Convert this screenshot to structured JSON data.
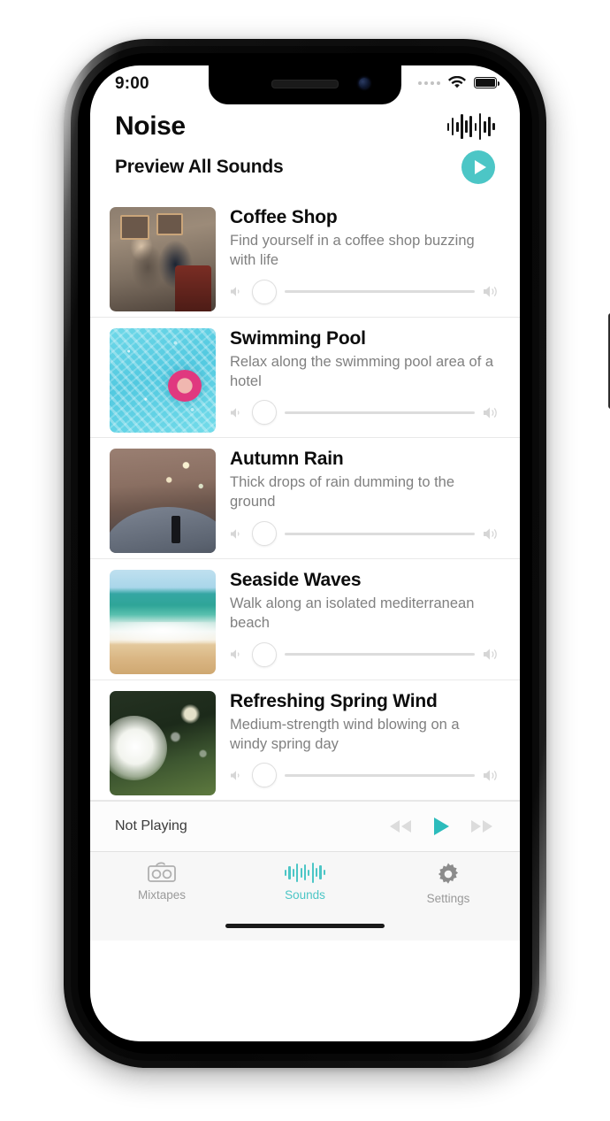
{
  "status_bar": {
    "time": "9:00",
    "signal_icon": "signal-dots-icon",
    "wifi_icon": "wifi-icon",
    "battery_icon": "battery-full-icon"
  },
  "header": {
    "app_title": "Noise",
    "waveform_icon": "waveform-icon",
    "preview_label": "Preview All Sounds",
    "preview_play_icon": "play-circle-icon"
  },
  "colors": {
    "accent": "#4cc6c6",
    "title_text": "#0c0c0c",
    "description_text": "#808080",
    "track": "#dcdcdc",
    "tab_inactive": "#9a9a9a"
  },
  "sounds": [
    {
      "title": "Coffee Shop",
      "description": "Find yourself in a coffee shop buzzing with life",
      "thumbnail": "coffee-shop-photo",
      "volume": 0,
      "volume_low_icon": "speaker-low-icon",
      "volume_high_icon": "speaker-high-icon"
    },
    {
      "title": "Swimming Pool",
      "description": "Relax along the swimming pool area of a hotel",
      "thumbnail": "swimming-pool-photo",
      "volume": 0,
      "volume_low_icon": "speaker-low-icon",
      "volume_high_icon": "speaker-high-icon"
    },
    {
      "title": "Autumn Rain",
      "description": "Thick drops of rain dumming to the ground",
      "thumbnail": "autumn-rain-photo",
      "volume": 0,
      "volume_low_icon": "speaker-low-icon",
      "volume_high_icon": "speaker-high-icon"
    },
    {
      "title": "Seaside Waves",
      "description": "Walk along an isolated mediterranean beach",
      "thumbnail": "seaside-waves-photo",
      "volume": 0,
      "volume_low_icon": "speaker-low-icon",
      "volume_high_icon": "speaker-high-icon"
    },
    {
      "title": "Refreshing Spring Wind",
      "description": "Medium-strength wind blowing on a windy spring day",
      "thumbnail": "refreshing-spring-wind-photo",
      "volume": 0,
      "volume_low_icon": "speaker-low-icon",
      "volume_high_icon": "speaker-high-icon"
    }
  ],
  "now_playing": {
    "status": "Not Playing",
    "previous_icon": "rewind-icon",
    "play_icon": "play-icon",
    "next_icon": "fast-forward-icon"
  },
  "tab_bar": {
    "tabs": [
      {
        "label": "Mixtapes",
        "icon": "cassette-icon",
        "active": false
      },
      {
        "label": "Sounds",
        "icon": "waveform-icon",
        "active": true
      },
      {
        "label": "Settings",
        "icon": "gear-icon",
        "active": false
      }
    ]
  }
}
